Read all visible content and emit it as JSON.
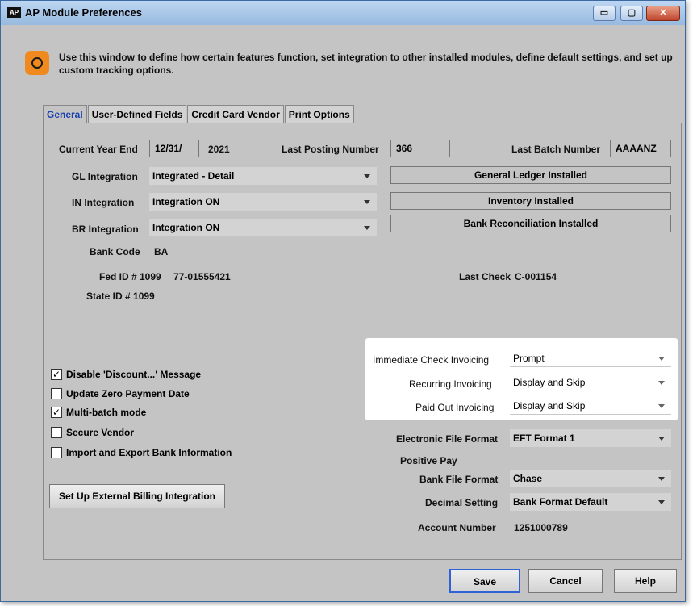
{
  "window": {
    "app_badge": "AP",
    "title": "AP Module Preferences",
    "minimize_label": "▭",
    "maximize_label": "▢",
    "close_label": "✕"
  },
  "intro": {
    "icon": "gear-icon",
    "text": "Use this window to define how certain features function, set integration to other installed modules, define default settings, and set up custom tracking options."
  },
  "tabs": [
    {
      "label": "General",
      "active": true
    },
    {
      "label": "User-Defined Fields",
      "active": false
    },
    {
      "label": "Credit Card Vendor",
      "active": false
    },
    {
      "label": "Print Options",
      "active": false
    }
  ],
  "general": {
    "current_year_end_label": "Current Year End",
    "current_year_end_value": "12/31/",
    "current_year_value": "2021",
    "last_posting_label": "Last Posting Number",
    "last_posting_value": "366",
    "last_batch_label": "Last Batch Number",
    "last_batch_value": "AAAANZ",
    "gl_label": "GL Integration",
    "gl_value": "Integrated - Detail",
    "gl_status": "General Ledger Installed",
    "in_label": "IN Integration",
    "in_value": "Integration ON",
    "in_status": "Inventory Installed",
    "br_label": "BR Integration",
    "br_value": "Integration ON",
    "br_status": "Bank Reconciliation Installed",
    "bank_code_label": "Bank Code",
    "bank_code_value": "BA",
    "fed_id_label": "Fed ID # 1099",
    "fed_id_value": "77-01555421",
    "last_check_label": "Last Check",
    "last_check_value": "C-001154",
    "state_id_label": "State ID # 1099"
  },
  "invoicing": {
    "immediate_label": "Immediate Check Invoicing",
    "immediate_value": "Prompt",
    "recurring_label": "Recurring Invoicing",
    "recurring_value": "Display and Skip",
    "paid_out_label": "Paid Out Invoicing",
    "paid_out_value": "Display and Skip"
  },
  "checkboxes": [
    {
      "label": "Disable 'Discount...' Message",
      "checked": true
    },
    {
      "label": "Update Zero Payment Date",
      "checked": false
    },
    {
      "label": "Multi-batch mode",
      "checked": true
    },
    {
      "label": "Secure Vendor",
      "checked": false
    },
    {
      "label": "Import and Export Bank Information",
      "checked": false
    }
  ],
  "external_billing_button": "Set Up External Billing Integration",
  "payments": {
    "efile_label": "Electronic File Format",
    "efile_value": "EFT Format 1",
    "positive_pay_label": "Positive Pay",
    "bank_file_label": "Bank File Format",
    "bank_file_value": "Chase",
    "decimal_label": "Decimal Setting",
    "decimal_value": "Bank Format Default",
    "account_label": "Account Number",
    "account_value": "1251000789"
  },
  "footer": {
    "save": "Save",
    "cancel": "Cancel",
    "help": "Help"
  }
}
